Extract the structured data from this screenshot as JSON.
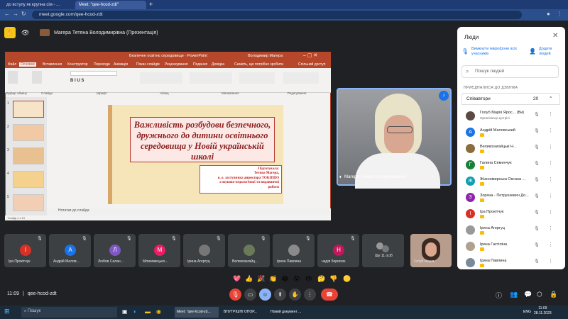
{
  "browser": {
    "tabs": [
      {
        "label": "до вступу як крупна сім - ..."
      },
      {
        "label": "Meet: \"qee-hcod-zdt\""
      }
    ],
    "new_tab": "+",
    "url": "meet.google.com/qee-hcod-zdt"
  },
  "meet": {
    "presenter": "Магера Тетяна Володимирівна (Презентація)",
    "powerpoint": {
      "title": "Безпечне освітнє середовище  ·  PowerPoint",
      "user": "Володимир Магера",
      "menu": [
        "Файл",
        "Основне",
        "Вставлення",
        "Конструктор",
        "Переходи",
        "Анімація",
        "Показ слайдів",
        "Рецензування",
        "Подання",
        "Довідка",
        "Скажіть, що потрібно зробити",
        "Спільний доступ"
      ],
      "ribbon_groups": [
        "Буфер обміну",
        "Слайди",
        "Шрифт",
        "Абзац",
        "Малювання",
        "Редагування"
      ],
      "slide_title": "Важливість розбудови безпечного, дружнього до дитини освітнього середовища у Новій українській школі",
      "author_lines": [
        "Підготувала:",
        "Тетяна Магера,",
        "в. о. заступника директора ТОКІППО",
        "з науково-педагогічної та видавничої",
        "роботи"
      ],
      "notes": "Нотатки до слайда",
      "thumbs": [
        "1",
        "2",
        "3",
        "4",
        "5"
      ],
      "status": "Слайд 1 з 13"
    },
    "camera_name": "Магера Тетяна Володимирівна",
    "participants": [
      {
        "name": "Іра Прокітчук",
        "initial": "І",
        "color": "#d93025"
      },
      {
        "name": "Андрій Малов...",
        "initial": "А",
        "color": "#1a73e8"
      },
      {
        "name": "Любов Салан...",
        "initial": "Л",
        "color": "#7e57c2"
      },
      {
        "name": "Млиновецько...",
        "initial": "М",
        "color": "#e91e63"
      },
      {
        "name": "Ірина Агергуц",
        "initial": "",
        "color": "#777777"
      },
      {
        "name": "Великозагайц...",
        "initial": "",
        "color": "#6b7b5a"
      },
      {
        "name": "Ірина Павлина",
        "initial": "",
        "color": "#8a8a8a"
      },
      {
        "name": "надія борисюк",
        "initial": "Н",
        "color": "#c2185b"
      },
      {
        "name": "Ще 11 осіб",
        "initial": "",
        "color": "#3c4043"
      },
      {
        "name": "Голуб Марія...",
        "initial": "",
        "color": "#8a7a70"
      }
    ],
    "reactions": [
      "💖",
      "👍",
      "🎉",
      "👏",
      "😂",
      "😮",
      "😢",
      "🤔",
      "👎",
      "🟡"
    ],
    "meeting_time": "11:09",
    "meeting_code": "qee-hcod-zdt"
  },
  "people_panel": {
    "title": "Люди",
    "mute_all": "Вимкнути мікрофони всіх учасників",
    "add_people": "Додати людей",
    "search_placeholder": "Пошук людей",
    "joined_label": "ПРИЄДНАЛИСЯ ДО ДЗВІНКА",
    "group": "Співавтори",
    "group_count": "20",
    "people": [
      {
        "name": "Голуб Марія Ярос... (Ви)",
        "sub": "Організатор зустрічі",
        "initial": "",
        "color": "#5b4a44"
      },
      {
        "name": "Андрій Маловський",
        "sub": "",
        "initial": "А",
        "color": "#1a73e8"
      },
      {
        "name": "Великозагайцькі Н...",
        "sub": "",
        "initial": "",
        "color": "#8a6d3b"
      },
      {
        "name": "Галина Семенчук",
        "sub": "",
        "initial": "Г",
        "color": "#188038"
      },
      {
        "name": "Жизномирська Оксана ...",
        "sub": "",
        "initial": "Ж",
        "color": "#129eaf"
      },
      {
        "name": "Зоряна - Петрункевич До...",
        "sub": "",
        "initial": "З",
        "color": "#8e24aa"
      },
      {
        "name": "Іра Прокітчук",
        "sub": "",
        "initial": "І",
        "color": "#d93025"
      },
      {
        "name": "Ірина Агергуц",
        "sub": "",
        "initial": "",
        "color": "#999999"
      },
      {
        "name": "Ірина Гастіліна",
        "sub": "",
        "initial": "",
        "color": "#b0a090"
      },
      {
        "name": "Ірина Павлина",
        "sub": "",
        "initial": "",
        "color": "#7a8a9a"
      }
    ]
  },
  "taskbar": {
    "search_placeholder": "Пошук",
    "apps": [
      {
        "label": "Meet: \"qee-hcod-zd..."
      },
      {
        "label": "ВНУТРІШНІ ОПОР..."
      },
      {
        "label": "Новий документ ..."
      }
    ],
    "lang": "ENG",
    "time": "11:09",
    "date": "28.11.2023"
  }
}
